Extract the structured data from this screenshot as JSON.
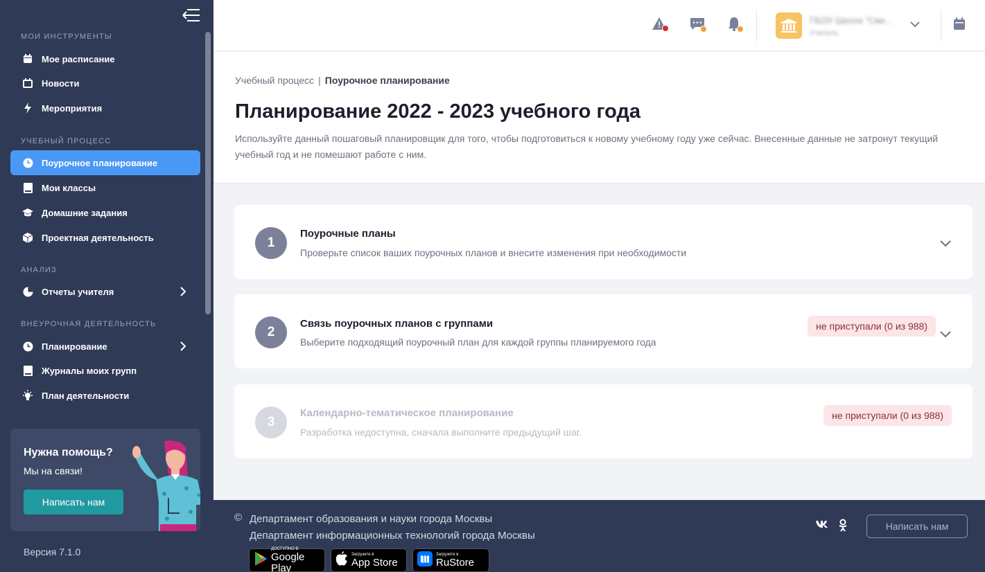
{
  "sidebar": {
    "sections": [
      {
        "title": "МОИ ИНСТРУМЕНТЫ"
      },
      {
        "title": "УЧЕБНЫЙ ПРОЦЕСС"
      },
      {
        "title": "АНАЛИЗ"
      },
      {
        "title": "ВНЕУРОЧНАЯ ДЕЯТЕЛЬНОСТЬ"
      }
    ],
    "items": [
      {
        "label": "Мое расписание",
        "icon": "calendar-icon"
      },
      {
        "label": "Новости",
        "icon": "news-icon"
      },
      {
        "label": "Мероприятия",
        "icon": "lightning-icon"
      },
      {
        "label": "Поурочное планирование",
        "icon": "clock-icon",
        "active": true
      },
      {
        "label": "Мои классы",
        "icon": "book-icon"
      },
      {
        "label": "Домашние задания",
        "icon": "graduation-cap-icon"
      },
      {
        "label": "Проектная деятельность",
        "icon": "cube-icon"
      },
      {
        "label": "Отчеты учителя",
        "icon": "pie-chart-icon"
      },
      {
        "label": "Планирование",
        "icon": "clock-icon"
      },
      {
        "label": "Журналы моих групп",
        "icon": "book-icon"
      },
      {
        "label": "План деятельности",
        "icon": "lightbulb-icon"
      }
    ],
    "help": {
      "title": "Нужна помощь?",
      "subtitle": "Мы на связи!",
      "button": "Написать нам"
    },
    "version": "Версия 7.1.0"
  },
  "header": {
    "org_name": "ГБОУ Школа \"Сви...",
    "org_role": "Учитель",
    "colors": {
      "alert_dot": "#d62b3a",
      "notify_dot": "#f0a040"
    }
  },
  "page": {
    "breadcrumb": {
      "parent": "Учебный процесс",
      "current": "Поурочное планирование"
    },
    "title": "Планирование 2022 - 2023 учебного года",
    "description": "Используйте данный пошаговый планировщик для того, чтобы подготовиться к новому учебному году уже сейчас. Внесенные данные не затронут текущий учебный год и не помешают работе с ним."
  },
  "steps": [
    {
      "num": "1",
      "title": "Поурочные планы",
      "desc": "Проверьте список ваших поурочных планов и внесите изменения при необходимости",
      "status": ""
    },
    {
      "num": "2",
      "title": "Связь поурочных планов с группами",
      "desc": "Выберите подходящий поурочный план для каждой группы планируемого года",
      "status": "не приступали (0 из 988)"
    },
    {
      "num": "3",
      "title": "Календарно-тематическое планирование",
      "desc": "Разработка недоступна, сначала выполните предыдущий шаг.",
      "status": "не приступали (0 из 988)"
    }
  ],
  "footer": {
    "copyright": "©",
    "line1": "Департамент образования и науки города Москвы",
    "line2": "Департамент информационных технологий города Москвы",
    "stores": [
      {
        "small": "ДОСТУПНО В",
        "big": "Google Play"
      },
      {
        "small": "Загрузите в",
        "big": "App Store"
      },
      {
        "small": "Загрузите в",
        "big": "RuStore"
      }
    ],
    "social": {
      "vk": "vk",
      "ok": "ok"
    },
    "write_button": "Написать нам"
  }
}
